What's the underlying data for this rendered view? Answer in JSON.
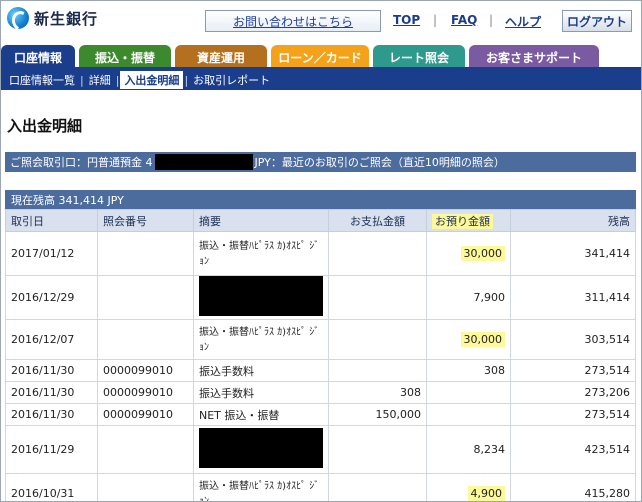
{
  "header": {
    "logo_text": "新生銀行",
    "inquiry": "お問い合わせはこちら",
    "top": "TOP",
    "faq": "FAQ",
    "help": "ヘルプ",
    "logout": "ログアウト",
    "separator": "|"
  },
  "tabs": [
    {
      "label": "口座情報",
      "color": "#1a3e8c"
    },
    {
      "label": "振込・振替",
      "color": "#3d8a2e"
    },
    {
      "label": "資産運用",
      "color": "#b5701f"
    },
    {
      "label": "ローン／カード",
      "color": "#f5a21b"
    },
    {
      "label": "レート照会",
      "color": "#2e9a8e"
    },
    {
      "label": "お客さまサポート",
      "color": "#7a5aa0"
    }
  ],
  "subnav": {
    "items": [
      "口座情報一覧",
      "詳細",
      "入出金明細",
      "お取引レポート"
    ],
    "active_index": 2
  },
  "page_title": "入出金明細",
  "notice": {
    "prefix": "ご照会取引口：円普通預金 4",
    "suffix": "JPY：最近のお取引のご照会（直近10明細の照会）"
  },
  "balance": "現在残高 341,414 JPY",
  "table": {
    "headers": [
      "取引日",
      "照会番号",
      "摘要",
      "お支払金額",
      "お預り金額",
      "残高"
    ],
    "rows": [
      {
        "date": "2017/01/12",
        "ref": "",
        "desc": "振込・振替ﾊﾋﾟﾗｽ ｶ)ｵｽﾋﾟ ｼﾞｮﾝ",
        "redacted": false,
        "pay": "",
        "deposit": "30,000",
        "deposit_hl": true,
        "balance": "341,414"
      },
      {
        "date": "2016/12/29",
        "ref": "",
        "desc": "",
        "redacted": true,
        "pay": "",
        "deposit": "7,900",
        "deposit_hl": false,
        "balance": "311,414"
      },
      {
        "date": "2016/12/07",
        "ref": "",
        "desc": "振込・振替ﾊﾋﾟﾗｽ ｶ)ｵｽﾋﾟ ｼﾞｮﾝ",
        "redacted": false,
        "pay": "",
        "deposit": "30,000",
        "deposit_hl": true,
        "balance": "303,514"
      },
      {
        "date": "2016/11/30",
        "ref": "0000099010",
        "desc": "振込手数料",
        "redacted": false,
        "pay": "",
        "deposit": "308",
        "deposit_hl": false,
        "balance": "273,514"
      },
      {
        "date": "2016/11/30",
        "ref": "0000099010",
        "desc": "振込手数料",
        "redacted": false,
        "pay": "308",
        "deposit": "",
        "deposit_hl": false,
        "balance": "273,206"
      },
      {
        "date": "2016/11/30",
        "ref": "0000099010",
        "desc": "NET 振込・振替",
        "redacted": false,
        "pay": "150,000",
        "deposit": "",
        "deposit_hl": false,
        "balance": "273,514"
      },
      {
        "date": "2016/11/29",
        "ref": "",
        "desc": "",
        "redacted": true,
        "pay": "",
        "deposit": "8,234",
        "deposit_hl": false,
        "balance": "423,514"
      },
      {
        "date": "2016/10/31",
        "ref": "",
        "desc": "振込・振替ﾊﾋﾟﾗｽ ｶ)ｵｽﾋﾟ ｼﾞｮﾝ",
        "redacted": false,
        "pay": "",
        "deposit": "4,900",
        "deposit_hl": true,
        "balance": "415,280"
      }
    ]
  }
}
